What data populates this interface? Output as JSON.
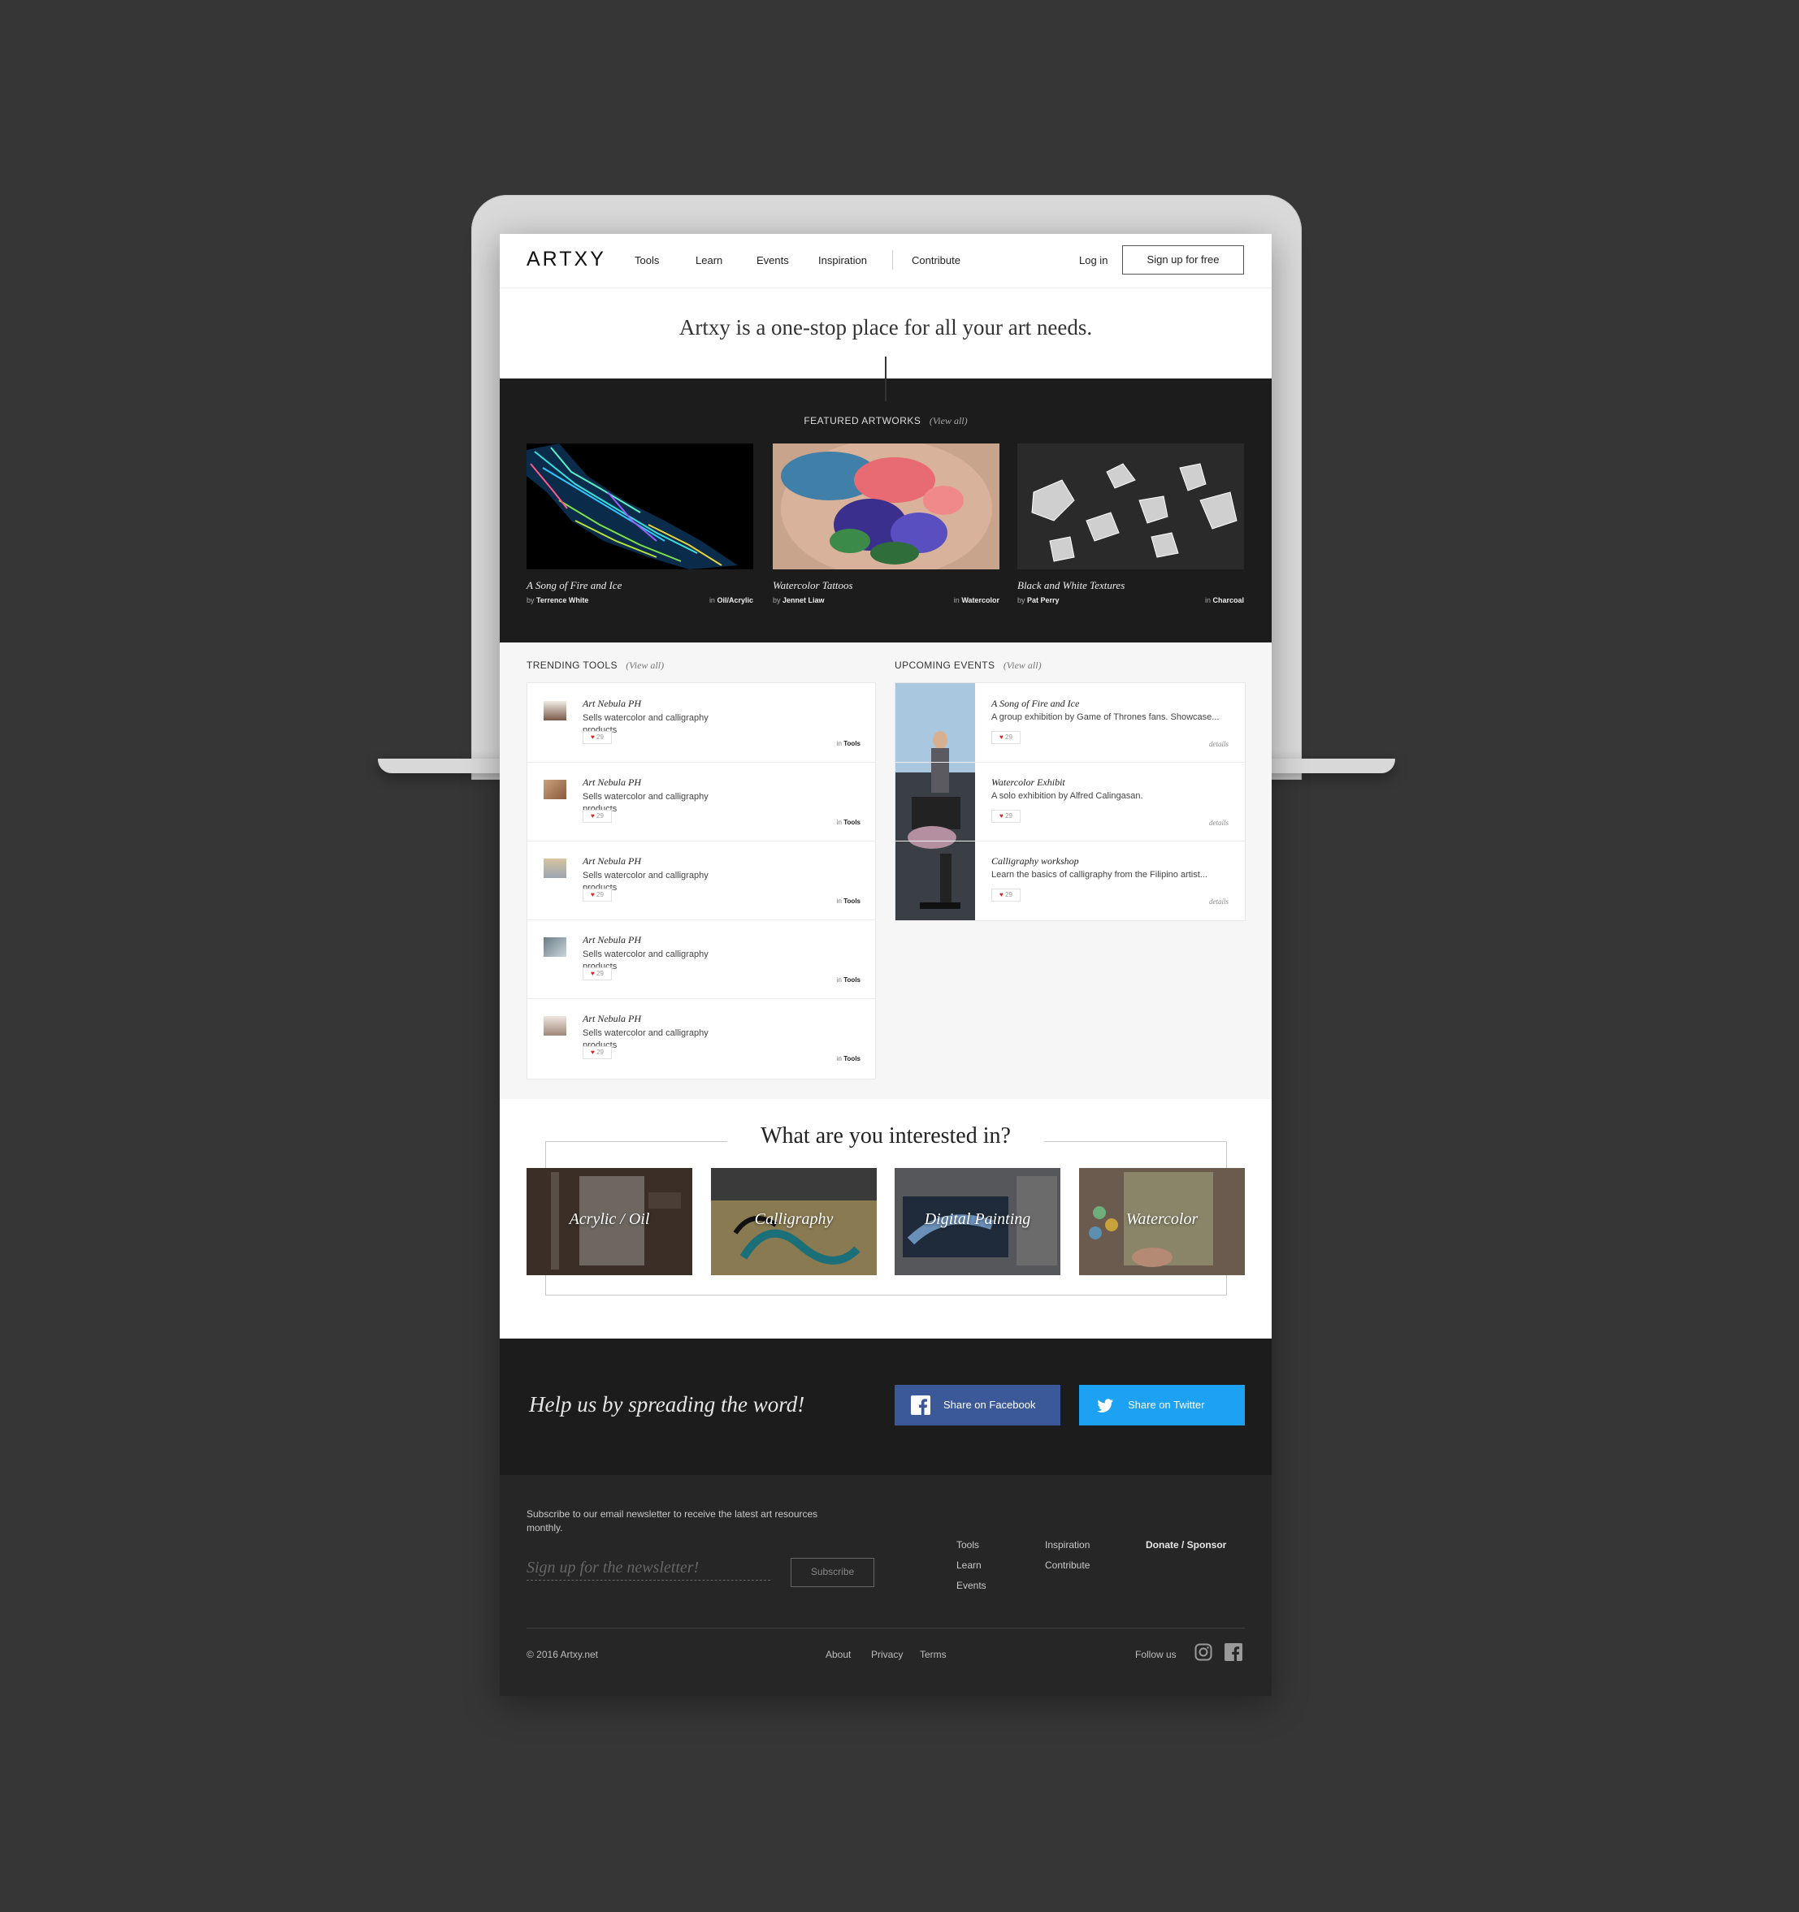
{
  "nav": {
    "logo": "ARTXY",
    "links": [
      "Tools",
      "Learn",
      "Events",
      "Inspiration",
      "Contribute"
    ],
    "login": "Log in",
    "signup": "Sign up for free"
  },
  "hero": {
    "tagline": "Artxy is a one-stop place for all your art needs."
  },
  "featured": {
    "title": "FEATURED ARTWORKS",
    "view_all": "(View all)",
    "items": [
      {
        "title": "A Song of Fire and Ice",
        "by_prefix": "by",
        "artist": "Terrence White",
        "in_prefix": "in",
        "category": "Oil/Acrylic"
      },
      {
        "title": "Watercolor Tattoos",
        "by_prefix": "by",
        "artist": "Jennet Liaw",
        "in_prefix": "in",
        "category": "Watercolor"
      },
      {
        "title": "Black and White Textures",
        "by_prefix": "by",
        "artist": "Pat Perry",
        "in_prefix": "in",
        "category": "Charcoal"
      }
    ]
  },
  "trending": {
    "title": "TRENDING TOOLS",
    "view_all": "(View all)",
    "items": [
      {
        "name": "Art Nebula PH",
        "desc": "Sells watercolor and calligraphy products",
        "likes": "29",
        "in_prefix": "in",
        "category": "Tools"
      },
      {
        "name": "Art Nebula PH",
        "desc": "Sells watercolor and calligraphy products",
        "likes": "29",
        "in_prefix": "in",
        "category": "Tools"
      },
      {
        "name": "Art Nebula PH",
        "desc": "Sells watercolor and calligraphy products",
        "likes": "29",
        "in_prefix": "in",
        "category": "Tools"
      },
      {
        "name": "Art Nebula PH",
        "desc": "Sells watercolor and calligraphy products",
        "likes": "29",
        "in_prefix": "in",
        "category": "Tools"
      },
      {
        "name": "Art Nebula PH",
        "desc": "Sells watercolor and calligraphy products",
        "likes": "29",
        "in_prefix": "in",
        "category": "Tools"
      }
    ]
  },
  "events": {
    "title": "UPCOMING EVENTS",
    "view_all": "(View all)",
    "items": [
      {
        "name": "A Song of Fire and Ice",
        "desc": "A group exhibition by Game of Thrones fans. Showcase...",
        "likes": "29",
        "details": "details"
      },
      {
        "name": "Watercolor Exhibit",
        "desc": "A solo exhibition by Alfred Calingasan.",
        "likes": "29",
        "details": "details"
      },
      {
        "name": "Calligraphy workshop",
        "desc": "Learn the basics of calligraphy from the Filipino artist...",
        "likes": "29",
        "details": "details"
      }
    ]
  },
  "interests": {
    "title": "What are you interested in?",
    "items": [
      "Acrylic / Oil",
      "Calligraphy",
      "Digital Painting",
      "Watercolor"
    ]
  },
  "share": {
    "text": "Help us by spreading the word!",
    "facebook": "Share on Facebook",
    "twitter": "Share on Twitter",
    "facebook_color": "#3b5998",
    "twitter_color": "#1da1f2"
  },
  "footer": {
    "newsletter_text": "Subscribe to our email newsletter to receive the latest art resources monthly.",
    "newsletter_placeholder": "Sign up for the newsletter!",
    "subscribe": "Subscribe",
    "col1": [
      "Tools",
      "Learn",
      "Events"
    ],
    "col2": [
      "Inspiration",
      "Contribute"
    ],
    "donate": "Donate / Sponsor",
    "copyright": "© 2016 Artxy.net",
    "bottom_links": [
      "About",
      "Privacy",
      "Terms"
    ],
    "follow": "Follow us"
  }
}
